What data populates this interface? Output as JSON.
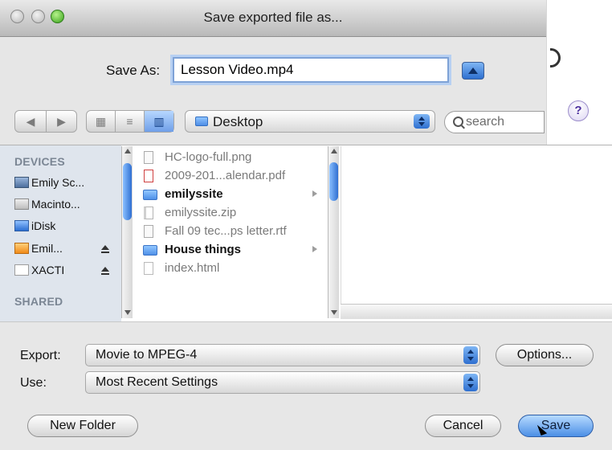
{
  "window": {
    "title": "Save exported file as..."
  },
  "save_as": {
    "label": "Save As:",
    "value": "Lesson Video.mp4"
  },
  "toolbar": {
    "location": "Desktop",
    "search_placeholder": "search"
  },
  "sidebar": {
    "devices_title": "DEVICES",
    "shared_title": "SHARED",
    "items": [
      {
        "label": "Emily Sc..."
      },
      {
        "label": "Macinto..."
      },
      {
        "label": "iDisk"
      },
      {
        "label": "Emil..."
      },
      {
        "label": "XACTI"
      }
    ]
  },
  "files": [
    {
      "name": "HC-logo-full.png"
    },
    {
      "name": "2009-201...alendar.pdf"
    },
    {
      "name": "emilyssite"
    },
    {
      "name": "emilyssite.zip"
    },
    {
      "name": "Fall 09 tec...ps letter.rtf"
    },
    {
      "name": "House things"
    },
    {
      "name": "index.html"
    }
  ],
  "options": {
    "export_label": "Export:",
    "export_value": "Movie to MPEG-4",
    "use_label": "Use:",
    "use_value": "Most Recent Settings",
    "options_button": "Options..."
  },
  "buttons": {
    "new_folder": "New Folder",
    "cancel": "Cancel",
    "save": "Save"
  }
}
